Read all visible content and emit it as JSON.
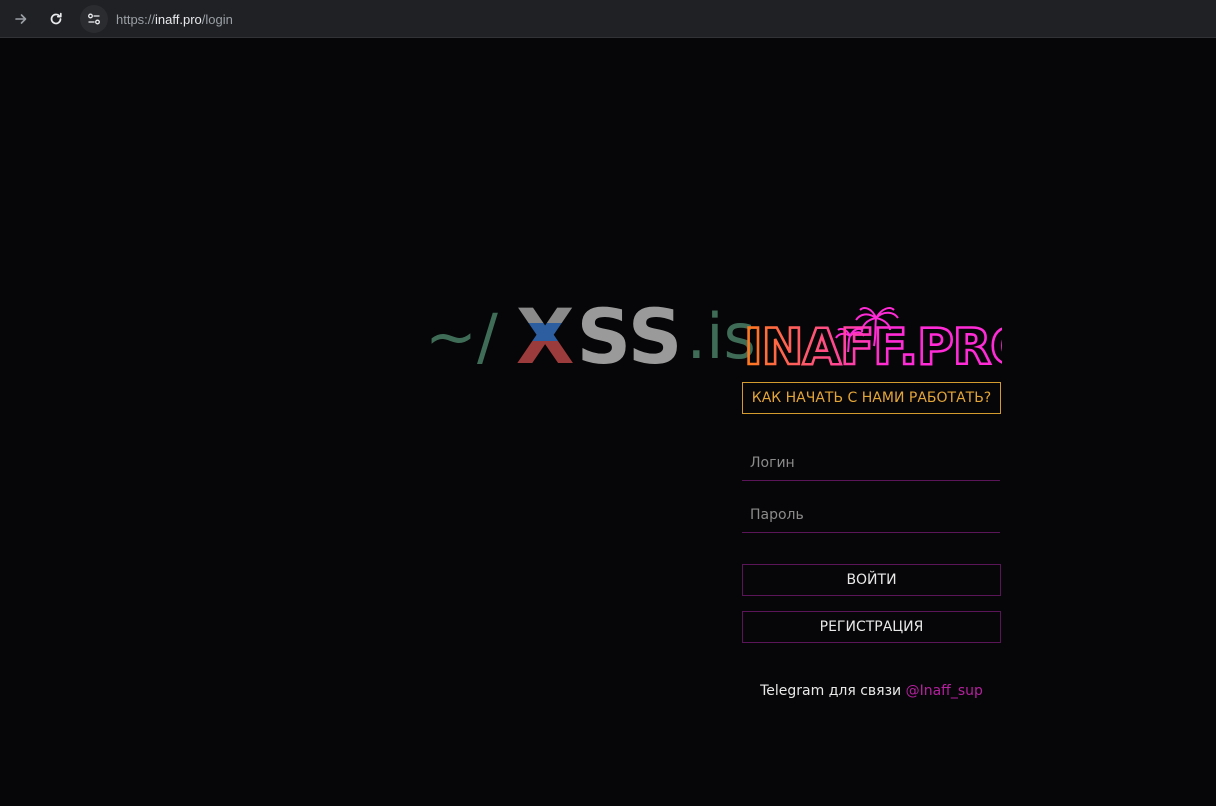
{
  "browser": {
    "url_scheme": "https://",
    "url_host": "inaff.pro",
    "url_path": "/login"
  },
  "watermark": {
    "tilde": "~/",
    "x": "X",
    "ss": "SS",
    "is": ".is"
  },
  "logo": {
    "text": "INAFF.PRO",
    "color_primary": "#ff2bd6",
    "color_secondary": "#ff7a1a"
  },
  "panel": {
    "howto_label": "КАК НАЧАТЬ С НАМИ РАБОТАТЬ?",
    "login_placeholder": "Логин",
    "password_placeholder": "Пароль",
    "login_button": "ВОЙТИ",
    "register_button": "РЕГИСТРАЦИЯ",
    "telegram_text": "Telegram для связи",
    "telegram_handle": "@Inaff_sup"
  },
  "colors": {
    "background": "#060507",
    "accent_orange": "#e2a53a",
    "accent_magenta": "#b3219e",
    "border_purple": "#5a1559"
  }
}
